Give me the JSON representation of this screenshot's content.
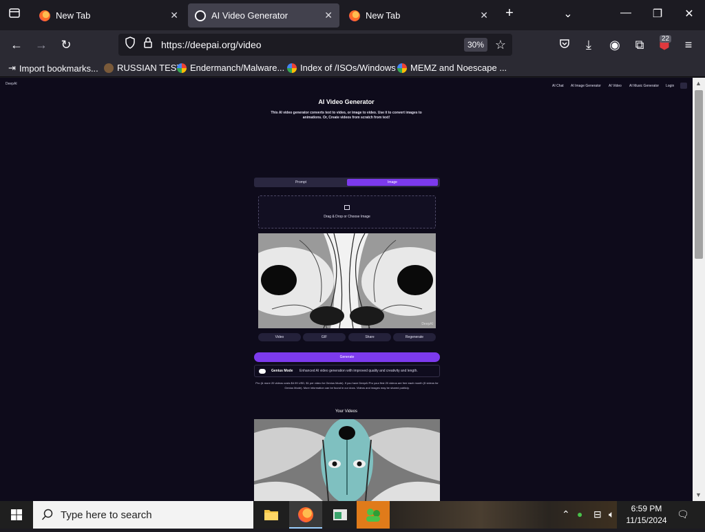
{
  "browser": {
    "tabs": [
      {
        "label": "New Tab",
        "active": false
      },
      {
        "label": "AI Video Generator",
        "active": true
      },
      {
        "label": "New Tab",
        "active": false
      }
    ],
    "url": "https://deepai.org/video",
    "zoom": "30%",
    "extension_badge": "22",
    "bookmarks": [
      "Import bookmarks...",
      "RUSSIAN TEST",
      "Endermanch/Malware...",
      "Index of /ISOs/Windows",
      "MEMZ and Noescape ..."
    ]
  },
  "site": {
    "logo": "DeepAI",
    "nav": [
      "AI Chat",
      "AI Image Generator",
      "AI Video",
      "AI Music Generator",
      "Login"
    ],
    "title": "AI Video Generator",
    "subtitle": "This AI video generator converts text to video, or image to video. Use it to convert images to animations. Or, Create videos from scratch from text!",
    "mode_tabs": [
      "Prompt",
      "Image"
    ],
    "active_mode": "Image",
    "dropzone_label": "Drag & Drop or Choose Image",
    "preview_mark": "DeepAI",
    "actions": [
      "Video",
      "GIF",
      "Share",
      "Regenerate"
    ],
    "generate_label": "Generate",
    "genius_label": "Genius Mode",
    "genius_desc": "Enhanced AI video generation with improved quality and creativity and length.",
    "pricing_text": "Pro (& more 20 videos costs $4.99 USD, $1 per video for Genius Mode). If you have DeepAI Pro your first 20 videos are free each month (5 videos for Genius Mode). More information can be found in our docs. Videos and images may be shared publicly.",
    "your_videos_label": "Your Videos"
  },
  "taskbar": {
    "search_placeholder": "Type here to search",
    "time": "6:59 PM",
    "date": "11/15/2024"
  },
  "colors": {
    "accent": "#7c3aed",
    "page_bg": "#0e0b1b",
    "browser_chrome": "#2b2a33"
  }
}
